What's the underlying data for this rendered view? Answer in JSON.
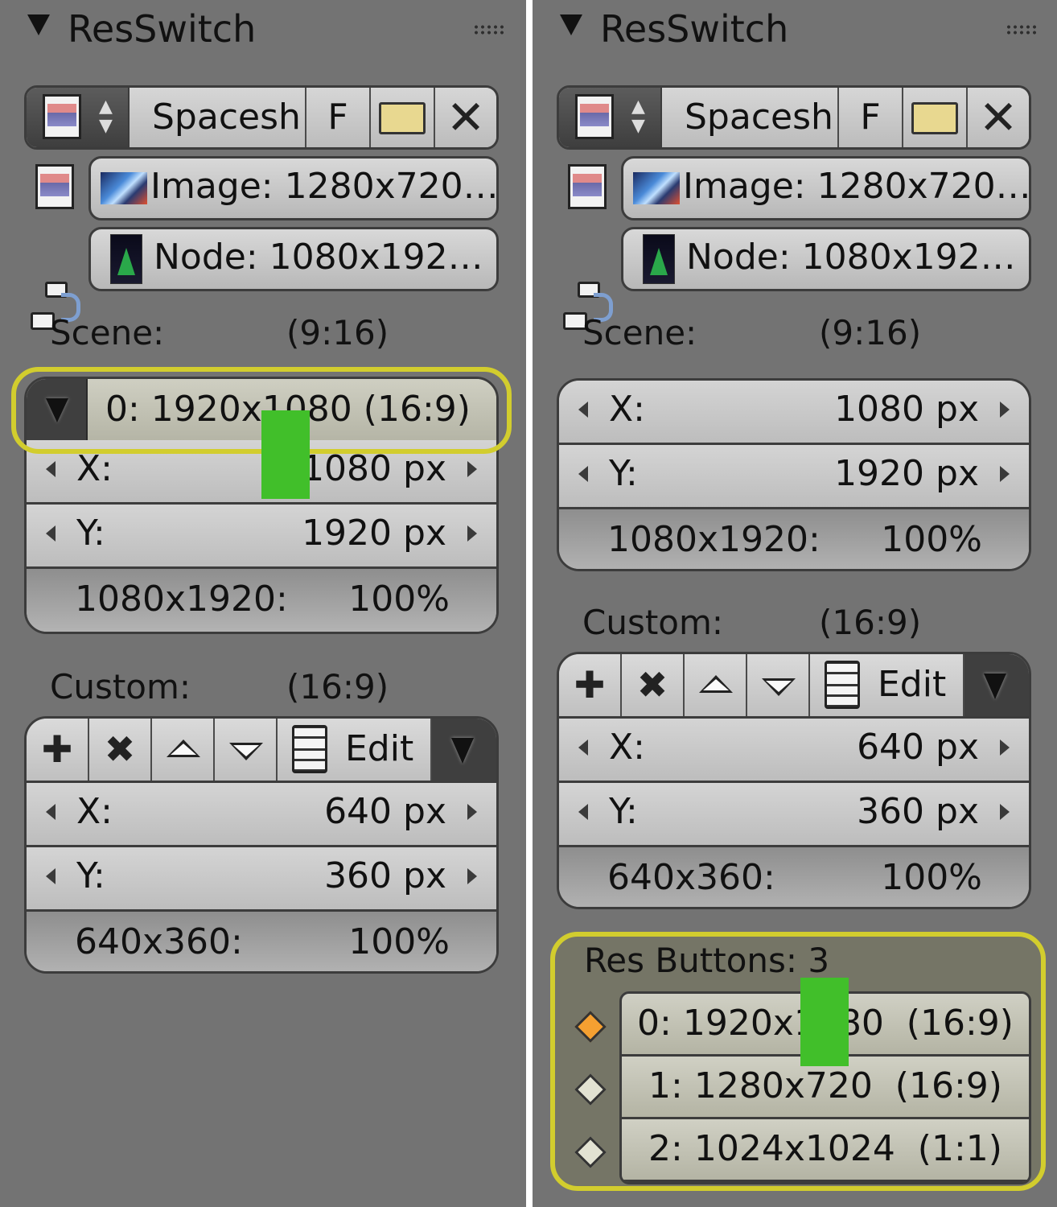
{
  "panels": [
    {
      "title": "ResSwitch",
      "toolbar": {
        "name": "Spacesh",
        "f_label": "F",
        "close_glyph": "✕"
      },
      "image_field": "Image: 1280x720…",
      "node_field": "Node: 1080x192…",
      "scene": {
        "label": "Scene:",
        "ratio": "(9:16)"
      },
      "scene_menu": "0: 1920x1080  (16:9)",
      "scene_fields": {
        "x_label": "X:",
        "x_value": "1080 px",
        "y_label": "Y:",
        "y_value": "1920 px",
        "pct_label": "1080x1920:",
        "pct_value": "100%"
      },
      "custom": {
        "label": "Custom:",
        "ratio": "(16:9)"
      },
      "custom_buttons": {
        "edit": "Edit"
      },
      "custom_fields": {
        "x_label": "X:",
        "x_value": "640 px",
        "y_label": "Y:",
        "y_value": "360 px",
        "pct_label": "640x360:",
        "pct_value": "100%"
      }
    },
    {
      "title": "ResSwitch",
      "toolbar": {
        "name": "Spacesh",
        "f_label": "F",
        "close_glyph": "✕"
      },
      "image_field": "Image: 1280x720…",
      "node_field": "Node: 1080x192…",
      "scene": {
        "label": "Scene:",
        "ratio": "(9:16)"
      },
      "scene_fields": {
        "x_label": "X:",
        "x_value": "1080 px",
        "y_label": "Y:",
        "y_value": "1920 px",
        "pct_label": "1080x1920:",
        "pct_value": "100%"
      },
      "custom": {
        "label": "Custom:",
        "ratio": "(16:9)"
      },
      "custom_buttons": {
        "edit": "Edit"
      },
      "custom_fields": {
        "x_label": "X:",
        "x_value": "640 px",
        "y_label": "Y:",
        "y_value": "360 px",
        "pct_label": "640x360:",
        "pct_value": "100%"
      },
      "res_buttons": {
        "label": "Res Buttons: 3",
        "items": [
          "0: 1920x1080  (16:9)",
          "1: 1280x720  (16:9)",
          "2: 1024x1024  (1:1)"
        ]
      }
    }
  ],
  "colors": {
    "panel_bg": "#737373",
    "highlight": "#d2cd2e",
    "marker": "#41bf2a",
    "active_diamond": "#f5a031",
    "inactive_diamond": "#e2e2d2"
  },
  "icons": [
    "collapse-triangle-icon",
    "drag-grip-icon",
    "image-icon",
    "up-down-arrows-icon",
    "folder-open-icon",
    "close-icon",
    "node-icon",
    "menu-dropdown-icon",
    "plus-icon",
    "remove-icon",
    "move-up-icon",
    "move-down-icon",
    "notepad-icon",
    "diamond-icon"
  ]
}
